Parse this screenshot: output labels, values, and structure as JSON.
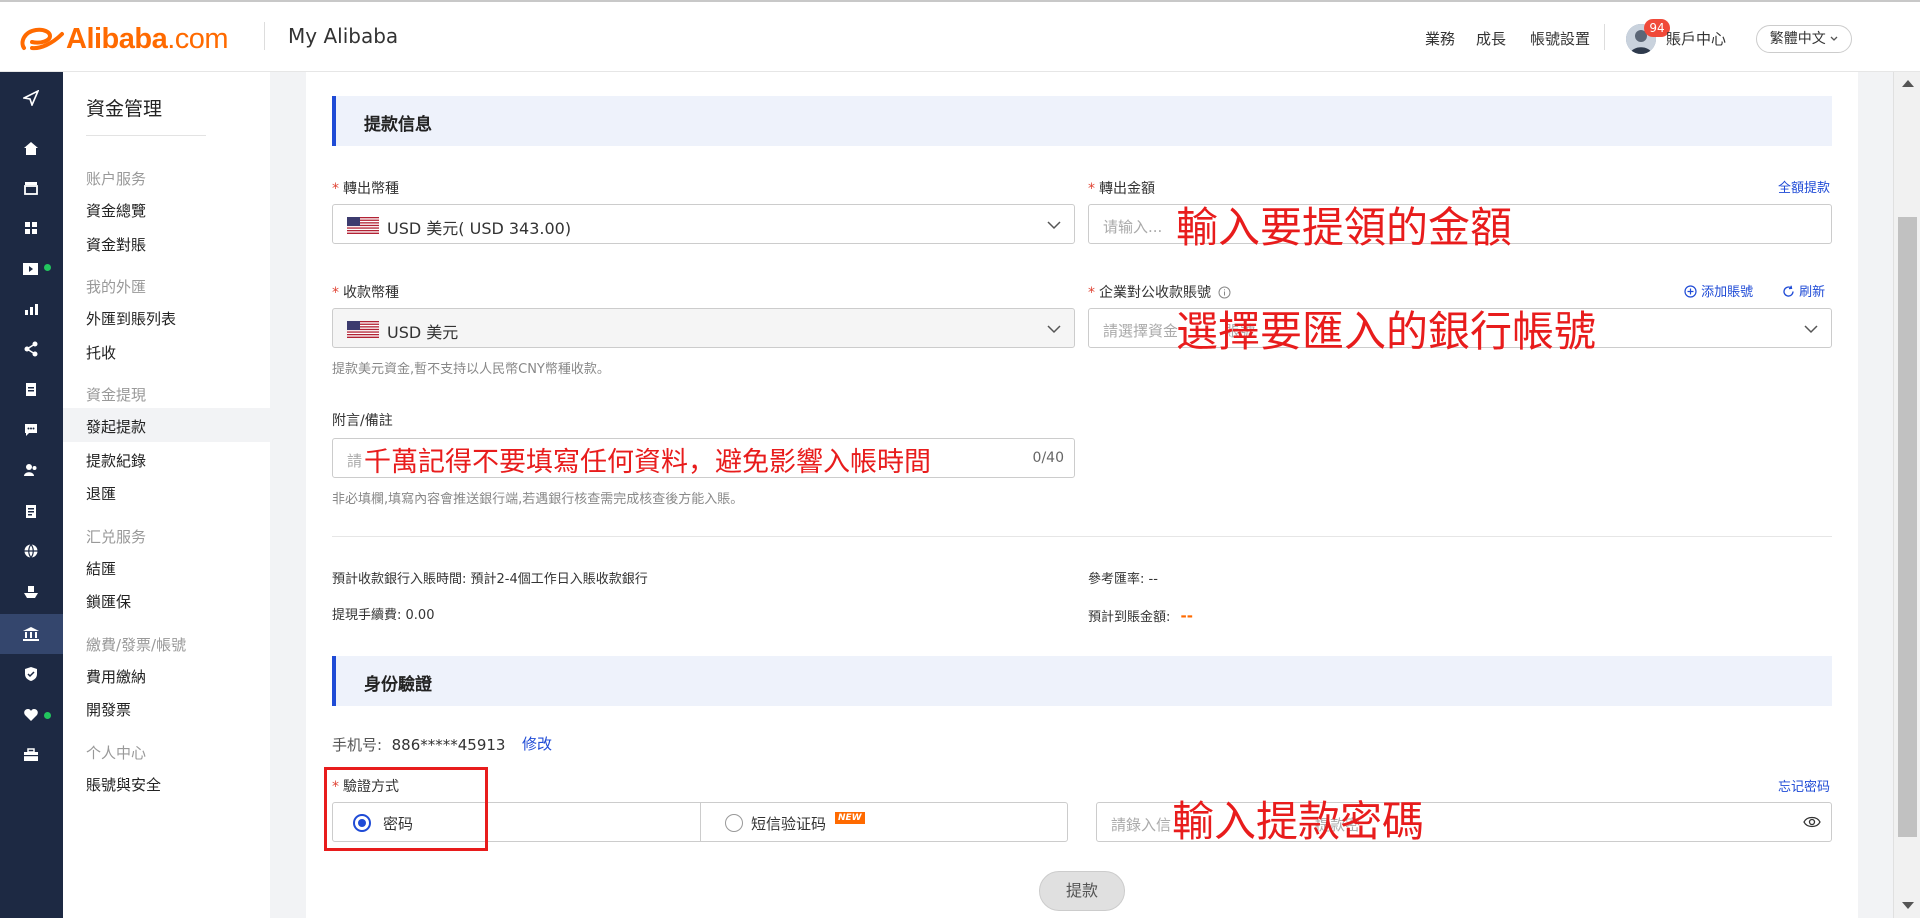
{
  "header": {
    "logo_text": "Alibaba",
    "logo_suffix": ".com",
    "title": "My Alibaba",
    "nav": [
      "業務",
      "成長",
      "帳號設置"
    ],
    "badge_count": "94",
    "account_center": "賬戶中心",
    "language": "繁體中文",
    "brand_color": "#ff6a00"
  },
  "rail": {
    "icons": [
      "send-icon",
      "home-icon",
      "store-icon",
      "apps-icon",
      "video-icon",
      "chart-icon",
      "share-icon",
      "clipboard-icon",
      "chat-icon",
      "users-icon",
      "document-icon",
      "globe-icon",
      "ship-icon",
      "bank-icon",
      "shield-icon",
      "heart-icon",
      "briefcase-icon"
    ],
    "active": "bank-icon"
  },
  "subnav": {
    "title": "資金管理",
    "groups": [
      {
        "label": "账户服务",
        "items": [
          "資金總覽",
          "資金對賬"
        ]
      },
      {
        "label": "我的外匯",
        "items": [
          "外匯到賬列表",
          "托收"
        ]
      },
      {
        "label": "資金提現",
        "items": [
          "發起提款",
          "提款紀錄",
          "退匯"
        ]
      },
      {
        "label": "汇兑服务",
        "items": [
          "結匯",
          "鎖匯保"
        ]
      },
      {
        "label": "繳費/發票/帳號",
        "items": [
          "費用繳納",
          "開發票"
        ]
      },
      {
        "label": "个人中心",
        "items": [
          "賬號與安全"
        ]
      }
    ],
    "active_item": "發起提款"
  },
  "withdraw": {
    "section_title": "提款信息",
    "out_currency_label": "轉出幣種",
    "out_currency_value": "USD 美元( USD 343.00)",
    "out_amount_label": "轉出金額",
    "full_withdraw_link": "全額提款",
    "amount_placeholder": "请输入...",
    "amount_annotation": "輸入要提領的金額",
    "recv_currency_label": "收款幣種",
    "recv_currency_value": "USD 美元",
    "recv_currency_hint": "提款美元資金,暫不支持以人民幣CNY幣種收款。",
    "account_label": "企業對公收款賬號",
    "add_account_link": "添加賬號",
    "refresh_link": "刷新",
    "account_placeholder": "請選擇資金",
    "account_placeholder_tail": "賬號",
    "account_annotation": "選擇要匯入的銀行帳號",
    "remark_label": "附言/備註",
    "remark_placeholder": "請",
    "remark_counter": "0/40",
    "remark_annotation": "千萬記得不要填寫任何資料，避免影響入帳時間",
    "remark_hint": "非必填欄,填寫內容會推送銀行端,若遇銀行核查需完成核查後方能入賬。",
    "arrival_time_label": "預計收款銀行入賬時間:",
    "arrival_time_value": "預計2-4個工作日入賬收款銀行",
    "rate_label": "參考匯率:",
    "rate_value": "--",
    "fee_label": "提現手續費:",
    "fee_value": "0.00",
    "expected_amount_label": "預計到賬金額:",
    "expected_amount_value": "--"
  },
  "verify": {
    "section_title": "身份驗證",
    "phone_label": "手机号:",
    "phone_value": "886*****45913",
    "modify_link": "修改",
    "method_label": "驗證方式",
    "forgot_password_link": "忘记密码",
    "option_password": "密码",
    "option_sms": "短信验证码",
    "new_tag": "NEW",
    "password_placeholder": "請錄入信",
    "password_placeholder_tail": "提款密",
    "password_annotation": "輸入提款密碼",
    "submit_label": "提款"
  }
}
